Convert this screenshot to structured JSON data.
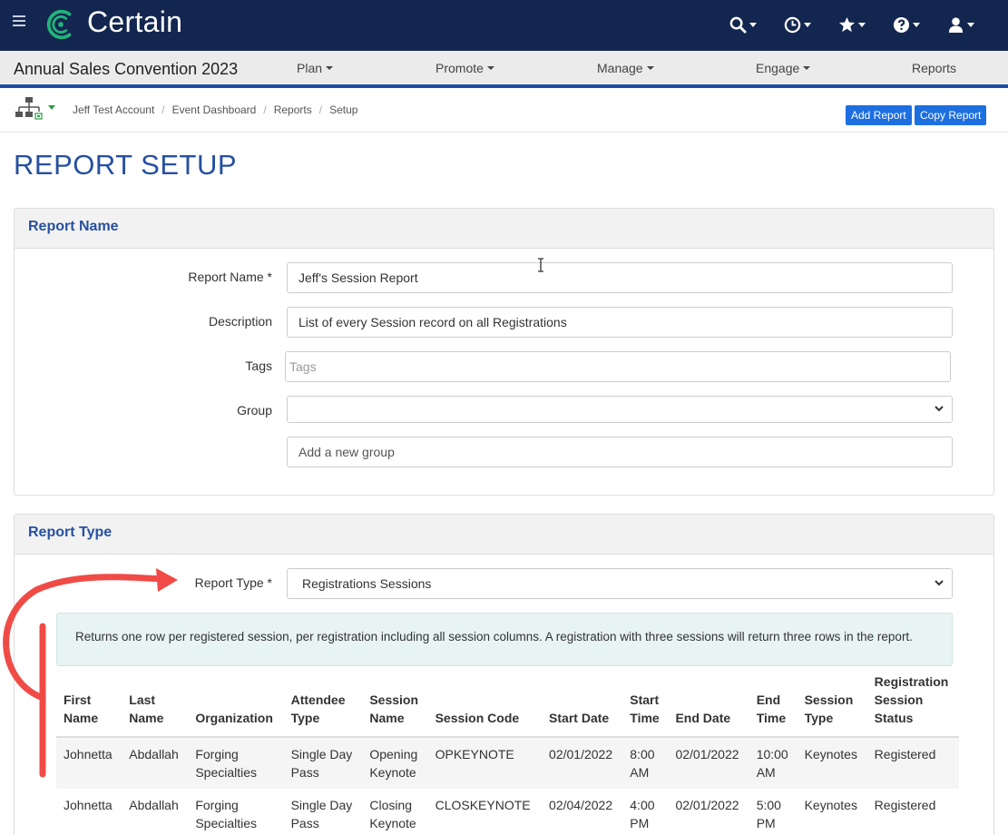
{
  "app": {
    "brand": "Certain",
    "colors": {
      "topbar": "#13264f",
      "accent": "#1e4da8",
      "brand_green": "#23b37a",
      "annotation": "#f04b46"
    }
  },
  "header_icons": [
    "search-icon",
    "clock-icon",
    "star-icon",
    "help-icon",
    "user-icon"
  ],
  "navbar": {
    "event_title": "Annual Sales Convention 2023",
    "items": [
      {
        "label": "Plan",
        "dropdown": true
      },
      {
        "label": "Promote",
        "dropdown": true
      },
      {
        "label": "Manage",
        "dropdown": true
      },
      {
        "label": "Engage",
        "dropdown": true
      },
      {
        "label": "Reports",
        "dropdown": false
      }
    ]
  },
  "breadcrumb": [
    "Jeff Test Account",
    "Event Dashboard",
    "Reports",
    "Setup"
  ],
  "actions": {
    "add_report": "Add Report",
    "copy_report": "Copy Report"
  },
  "page_title": "REPORT SETUP",
  "report_name_panel": {
    "title": "Report Name",
    "fields": {
      "name_label": "Report Name",
      "required": "*",
      "name_value": "Jeff's Session Report",
      "description_label": "Description",
      "description_value": "List of every Session record on all Registrations",
      "tags_label": "Tags",
      "tags_placeholder": "Tags",
      "group_label": "Group",
      "group_value": "",
      "new_group_placeholder": "Add a new group"
    }
  },
  "report_type_panel": {
    "title": "Report Type",
    "type_label": "Report Type",
    "required": "*",
    "type_value": "Registrations Sessions",
    "info": "Returns one row per registered session, per registration including all session columns. A registration with three sessions will return three rows in the report.",
    "columns": [
      [
        "First",
        "Name"
      ],
      [
        "Last",
        "Name"
      ],
      [
        "Organization"
      ],
      [
        "Attendee",
        "Type"
      ],
      [
        "Session",
        "Name"
      ],
      [
        "Session Code"
      ],
      [
        "Start Date"
      ],
      [
        "Start",
        "Time"
      ],
      [
        "End Date"
      ],
      [
        "End",
        "Time"
      ],
      [
        "Session",
        "Type"
      ],
      [
        "Registration",
        "Session",
        "Status"
      ]
    ],
    "rows": [
      [
        "Johnetta",
        "Abdallah",
        [
          "Forging",
          "Specialties"
        ],
        [
          "Single Day",
          "Pass"
        ],
        [
          "Opening",
          "Keynote"
        ],
        "OPKEYNOTE",
        "02/01/2022",
        [
          "8:00",
          "AM"
        ],
        "02/01/2022",
        [
          "10:00",
          "AM"
        ],
        "Keynotes",
        "Registered"
      ],
      [
        "Johnetta",
        "Abdallah",
        [
          "Forging",
          "Specialties"
        ],
        [
          "Single Day",
          "Pass"
        ],
        [
          "Closing",
          "Keynote"
        ],
        "CLOSKEYNOTE",
        "02/04/2022",
        [
          "4:00",
          "PM"
        ],
        "02/01/2022",
        [
          "5:00",
          "PM"
        ],
        "Keynotes",
        "Registered"
      ]
    ]
  }
}
